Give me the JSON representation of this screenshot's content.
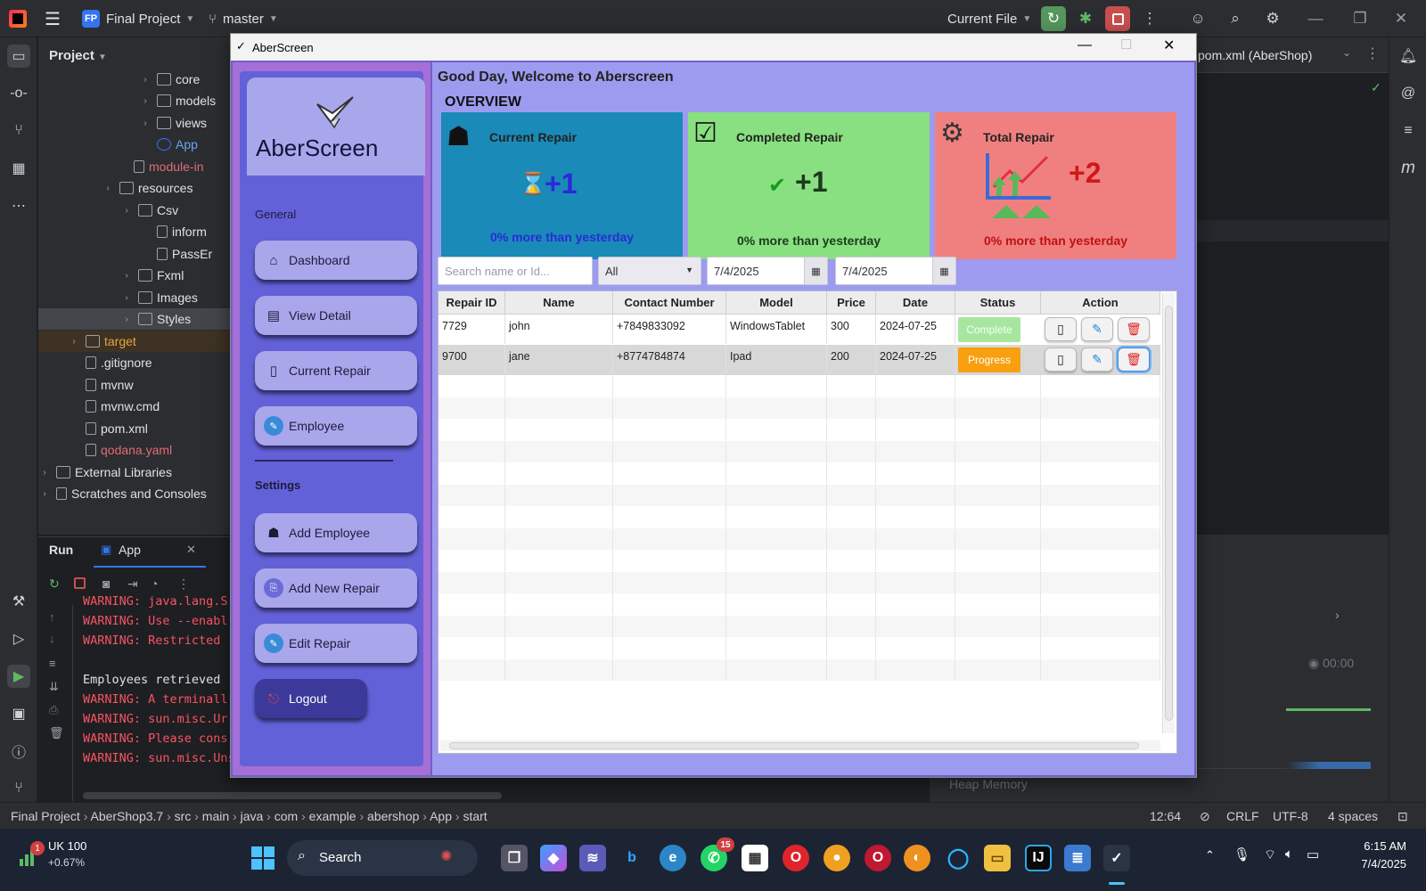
{
  "ide": {
    "project_badge": "FP",
    "project_name": "Final Project",
    "branch": "master",
    "run_config": "Current File",
    "editor_tab": "pom.xml (AberShop)",
    "project_panel_title": "Project",
    "tree": [
      {
        "label": "core",
        "indent": 0
      },
      {
        "label": "models",
        "indent": 0
      },
      {
        "label": "views",
        "indent": 0
      },
      {
        "label": "App",
        "indent": 0
      },
      {
        "label": "module-in",
        "indent": 0
      },
      {
        "label": "resources",
        "indent": 0
      },
      {
        "label": "Csv",
        "indent": 0
      },
      {
        "label": "inform",
        "indent": 0
      },
      {
        "label": "PassEr",
        "indent": 0
      },
      {
        "label": "Fxml",
        "indent": 0
      },
      {
        "label": "Images",
        "indent": 0
      },
      {
        "label": "Styles",
        "indent": 0
      },
      {
        "label": "target",
        "indent": 0
      },
      {
        "label": ".gitignore",
        "indent": 0
      },
      {
        "label": "mvnw",
        "indent": 0
      },
      {
        "label": "mvnw.cmd",
        "indent": 0
      },
      {
        "label": "pom.xml",
        "indent": 0
      },
      {
        "label": "qodana.yaml",
        "indent": 0
      },
      {
        "label": "External Libraries",
        "indent": 0
      },
      {
        "label": "Scratches and Consoles",
        "indent": 0
      }
    ],
    "run_tab_run": "Run",
    "run_tab_app": "App",
    "console": [
      "WARNING: java.lang.S",
      "WARNING: Use --enabl",
      "WARNING: Restricted",
      "",
      "Employees retrieved",
      "WARNING: A terminall",
      "WARNING: sun.misc.Ur",
      "WARNING: Please cons",
      "WARNING: sun.misc.Unsafe::allocateMemory will be removed in a future release"
    ],
    "timer": "00:00",
    "heap_label": "Heap Memory",
    "breadcrumb": [
      "Final Project",
      "AberShop3.7",
      "src",
      "main",
      "java",
      "com",
      "example",
      "abershop",
      "App",
      "start"
    ],
    "status_right": {
      "pos": "12:64",
      "eol": "CRLF",
      "enc": "UTF-8",
      "indent": "4 spaces"
    }
  },
  "taskbar": {
    "stock_name": "UK 100",
    "stock_change": "+0.67%",
    "stock_badge": "1",
    "search": "Search",
    "whatsapp_badge": "15",
    "time": "6:15 AM",
    "date": "7/4/2025"
  },
  "app": {
    "window_title": "AberScreen",
    "brand": "AberScreen",
    "greeting": "Good Day, Welcome to Aberscreen",
    "overview": "OVERVIEW",
    "section_general": "General",
    "section_settings": "Settings",
    "nav": {
      "dashboard": "Dashboard",
      "view_detail": "View Detail",
      "current_repair": "Current Repair",
      "employee": "Employee",
      "add_employee": "Add Employee",
      "add_new_repair": "Add New Repair",
      "edit_repair": "Edit Repair",
      "logout": "Logout"
    },
    "cards": {
      "current": {
        "title": "Current Repair",
        "value": "+1",
        "sub": "0% more than yesterday",
        "color": "#1a8ab8"
      },
      "completed": {
        "title": "Completed Repair",
        "value": "+1",
        "sub": "0% more than yesterday",
        "color": "#88e080"
      },
      "total": {
        "title": "Total Repair",
        "value": "+2",
        "sub": "0%  more than yesterday",
        "color": "#f08080"
      }
    },
    "filters": {
      "search_placeholder": "Search name or Id...",
      "status_filter": "All",
      "date_from": "7/4/2025",
      "date_to": "7/4/2025"
    },
    "table": {
      "headers": [
        "Repair ID",
        "Name",
        "Contact Number",
        "Model",
        "Price",
        "Date",
        "Status",
        "Action"
      ],
      "rows": [
        {
          "id": "7729",
          "name": "john",
          "contact": "+7849833092",
          "model": "WindowsTablet",
          "price": "300",
          "date": "2024-07-25",
          "status": "Complete"
        },
        {
          "id": "9700",
          "name": "jane",
          "contact": "+8774784874",
          "model": "Ipad",
          "price": "200",
          "date": "2024-07-25",
          "status": "Progress"
        }
      ]
    }
  }
}
